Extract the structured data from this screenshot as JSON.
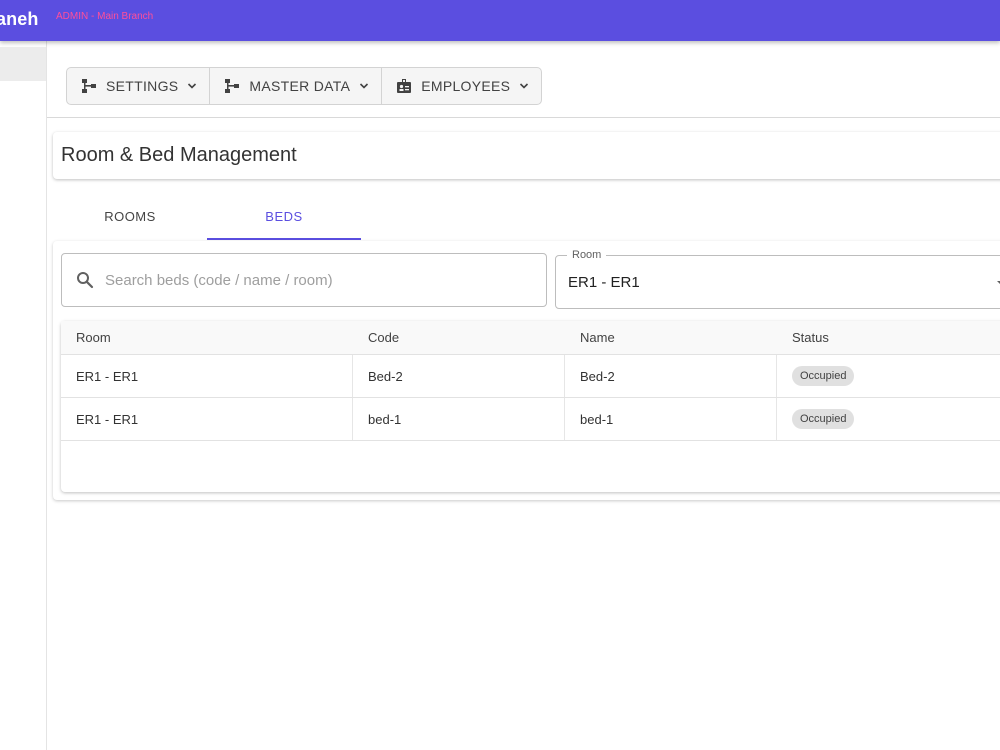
{
  "appbar": {
    "brand": "aneh",
    "subtitle": "ADMIN - Main Branch",
    "color": "#5b4ee0",
    "subtitle_color": "#ff4f9a"
  },
  "menu": {
    "items": [
      {
        "label": "SETTINGS",
        "icon": "hierarchy-icon"
      },
      {
        "label": "MASTER DATA",
        "icon": "hierarchy-icon"
      },
      {
        "label": "EMPLOYEES",
        "icon": "id-badge-icon"
      }
    ]
  },
  "page": {
    "title": "Room & Bed Management"
  },
  "tabs": [
    {
      "label": "ROOMS",
      "active": false
    },
    {
      "label": "BEDS",
      "active": true
    }
  ],
  "filters": {
    "search_placeholder": "Search beds (code / name / room)",
    "room_label": "Room",
    "room_value": "ER1 - ER1"
  },
  "table": {
    "columns": [
      "Room",
      "Code",
      "Name",
      "Status"
    ],
    "rows": [
      {
        "room": "ER1 - ER1",
        "code": "Bed-2",
        "name": "Bed-2",
        "status": "Occupied"
      },
      {
        "room": "ER1 - ER1",
        "code": "bed-1",
        "name": "bed-1",
        "status": "Occupied"
      }
    ]
  },
  "colors": {
    "accent": "#5b4ee0",
    "badge_bg": "#e0e0e0"
  }
}
